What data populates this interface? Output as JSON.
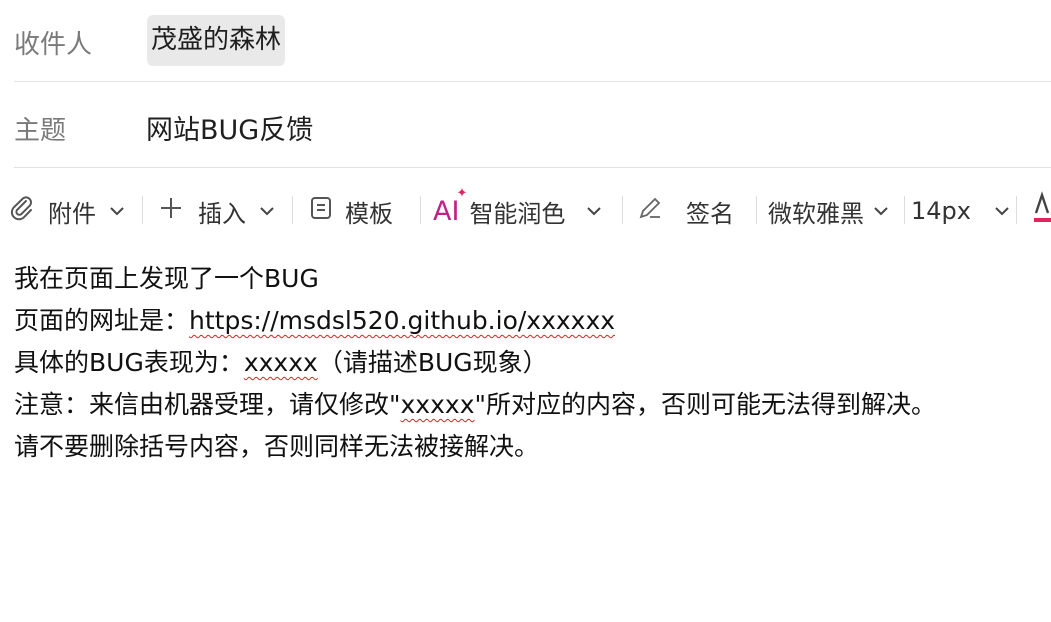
{
  "recipient": {
    "label": "收件人",
    "value": "茂盛的森林"
  },
  "subject": {
    "label": "主题",
    "value": "网站BUG反馈"
  },
  "toolbar": {
    "attachment": "附件",
    "insert": "插入",
    "template": "模板",
    "ai_mark": "AI",
    "ai_polish": "智能润色",
    "signature": "签名",
    "font_family": "微软雅黑",
    "font_size": "14px",
    "colors": {
      "ai": "#c0208a",
      "text_color_underline": "#e0245e"
    }
  },
  "body": {
    "line1": "我在页面上发现了一个BUG",
    "line2_prefix": "页面的网址是：",
    "line2_url": "https://msdsl520.github.io/xxxxxx",
    "line3_prefix": "具体的BUG表现为：",
    "line3_placeholder": "xxxxx",
    "line3_suffix": "（请描述BUG现象）",
    "line4_prefix": "注意：来信由机器受理，请仅修改\"",
    "line4_placeholder": "xxxxx",
    "line4_suffix": "\"所对应的内容，否则可能无法得到解决。",
    "line5": "请不要删除括号内容，否则同样无法被接解决。"
  }
}
